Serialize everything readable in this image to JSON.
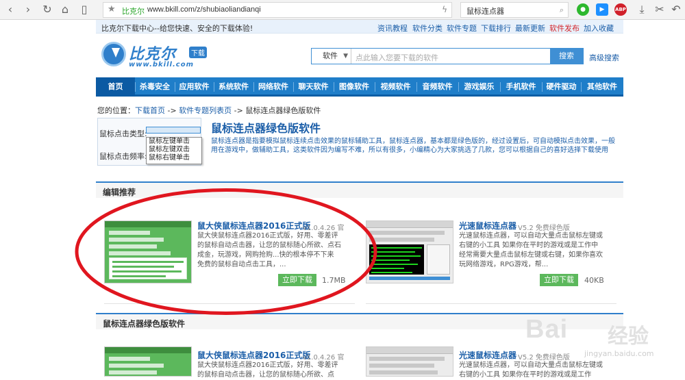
{
  "browser": {
    "site_name": "比克尔",
    "url": "www.bkill.com/z/shubiaoliandianqi",
    "tab_title": "鼠标连点器",
    "abp_label": "ABP"
  },
  "topbar": {
    "slogan": "比克尔下载中心--给您快速、安全的下载体验!",
    "links": [
      "资讯教程",
      "软件分类",
      "软件专题",
      "下载排行",
      "最新更新",
      "软件发布",
      "加入收藏"
    ]
  },
  "logo": {
    "name": "比克尔",
    "tag": "下载",
    "domain": "www.bkill.com"
  },
  "search": {
    "type_label": "软件",
    "placeholder": "点此输入您要下载的软件",
    "button_label": "搜索",
    "advanced_label": "高级搜索"
  },
  "nav": [
    "首页",
    "杀毒安全",
    "应用软件",
    "系统软件",
    "网络软件",
    "聊天软件",
    "图像软件",
    "视频软件",
    "音频软件",
    "游戏娱乐",
    "手机软件",
    "硬件驱动",
    "其他软件"
  ],
  "breadcrumb": {
    "prefix": "您的位置：",
    "home": "下载首页",
    "sep1": " -> ",
    "list": "软件专题列表页",
    "sep2": " -> ",
    "current": "鼠标连点器绿色版软件"
  },
  "filter": {
    "click_type_label": "鼠标点击类型:",
    "click_freq_label": "鼠标点击频率:",
    "options": [
      "鼠标左键单击",
      "鼠标左键双击",
      "鼠标右键单击"
    ]
  },
  "heading": {
    "title": "鼠标连点器绿色版软件",
    "description": "鼠标连点器是指要模拟鼠标连续点击效果的鼠标辅助工具，鼠标连点器，基本都是绿色版的，经过设置后，可自动模拟点击效果，一般用在游戏中，做辅助工具，这类软件因为编写不难，所以有很多，小编精心为大家挑选了几款，您可以根据自己的喜好选择下载使用"
  },
  "section_editor": {
    "title": "编辑推荐"
  },
  "section_list": {
    "title": "鼠标连点器绿色版软件"
  },
  "products": [
    {
      "title": "鼠大侠鼠标连点器2016正式版",
      "version": "v1.0.4.26 官",
      "desc": "鼠大侠鼠标连点器2016正式版，好用、零差评的鼠标自动点击器，让您的鼠标随心所欲、点石成金，玩游戏，网购抢购...快的根本停不下来 免费的鼠标自动点击工具，...",
      "button": "立即下载",
      "size": "1.7MB"
    },
    {
      "title": "光速鼠标连点器",
      "version": "V5.2 免费绿色版",
      "desc": "光速鼠标连点器，可以自动大量点击鼠标左键或右键的小工具 如果你在平时的游戏或是工作中经常需要大量点击鼠标左键或右键，如果你喜欢玩网络游戏，RPG游戏，帮...",
      "button": "立即下载",
      "size": "40KB"
    },
    {
      "title": "鼠大侠鼠标连点器2016正式版",
      "version": "v1.0.4.26 官",
      "desc": "鼠大侠鼠标连点器2016正式版，好用、零差评的鼠标自动点击器，让您的鼠标随心所欲、点"
    },
    {
      "title": "光速鼠标连点器",
      "version": "V5.2 免费绿色版",
      "desc": "光速鼠标连点器，可以自动大量点击鼠标左键或右键的小工具 如果你在平时的游戏或是工作"
    }
  ],
  "watermark": {
    "text": "Bai",
    "text2": "经验",
    "url": "jingyan.baidu.com"
  },
  "colors": {
    "nav_blue": "#1f7ec9",
    "link_blue": "#1b5ea8",
    "download_green": "#5cb85c",
    "oval_red": "#e0161f"
  }
}
